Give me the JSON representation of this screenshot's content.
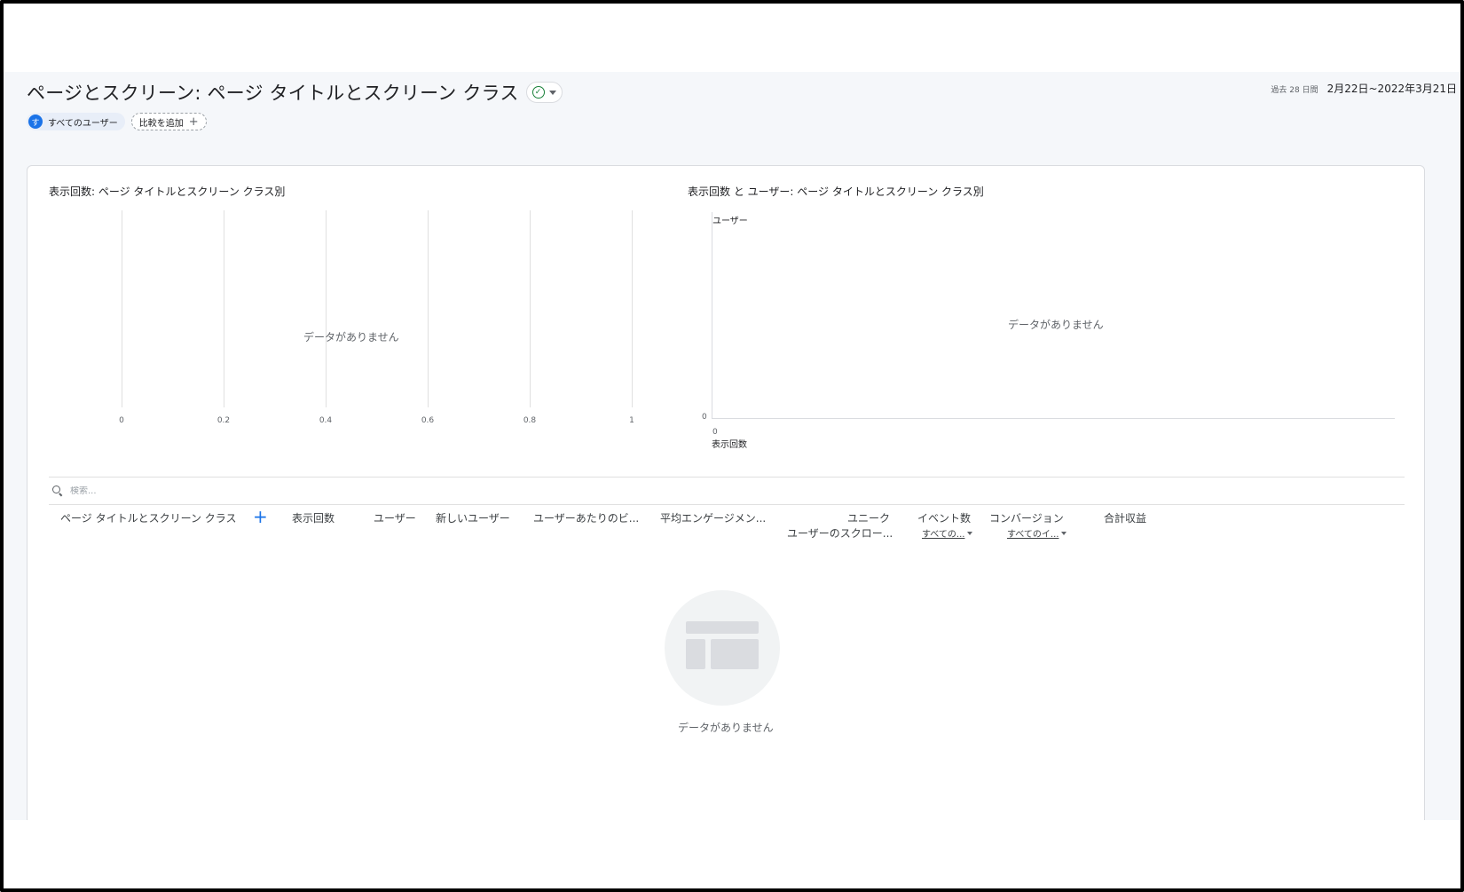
{
  "header": {
    "title": "ページとスクリーン: ページ タイトルとスクリーン クラス",
    "date_label": "過去 28 日間",
    "date_range": "2月22日~2022年3月21日"
  },
  "chips": {
    "all_users_avatar": "す",
    "all_users": "すべてのユーザー",
    "add_comparison": "比較を追加"
  },
  "bar_chart": {
    "title": "表示回数: ページ タイトルとスクリーン クラス別",
    "no_data": "データがありません",
    "ticks": [
      "0",
      "0.2",
      "0.4",
      "0.6",
      "0.8",
      "1"
    ]
  },
  "scatter_chart": {
    "title": "表示回数 と ユーザー: ページ タイトルとスクリーン クラス別",
    "no_data": "データがありません",
    "y_label": "ユーザー",
    "y_zero": "0",
    "x_zero": "0",
    "x_label": "表示回数"
  },
  "table": {
    "search_placeholder": "検索...",
    "columns": {
      "dimension": "ページ タイトルとスクリーン クラス",
      "views": "表示回数",
      "users": "ユーザー",
      "new_users": "新しいユーザー",
      "views_per_user": "ユーザーあたりのビ...",
      "avg_engagement": "平均エンゲージメン...",
      "unique_scroll_1": "ユニーク",
      "unique_scroll_2": "ユーザーのスクロー...",
      "event_count": "イベント数",
      "event_filter": "すべての...",
      "conversions": "コンバージョン",
      "conversion_filter": "すべてのイ...",
      "total_revenue": "合計収益"
    },
    "empty_text": "データがありません"
  },
  "chart_data": [
    {
      "type": "bar",
      "title": "表示回数: ページ タイトルとスクリーン クラス別",
      "categories": [],
      "values": [],
      "xlim": [
        0,
        1
      ],
      "x_ticks": [
        0,
        0.2,
        0.4,
        0.6,
        0.8,
        1
      ]
    },
    {
      "type": "scatter",
      "title": "表示回数 と ユーザー: ページ タイトルとスクリーン クラス別",
      "xlabel": "表示回数",
      "ylabel": "ユーザー",
      "x": [],
      "y": []
    }
  ]
}
